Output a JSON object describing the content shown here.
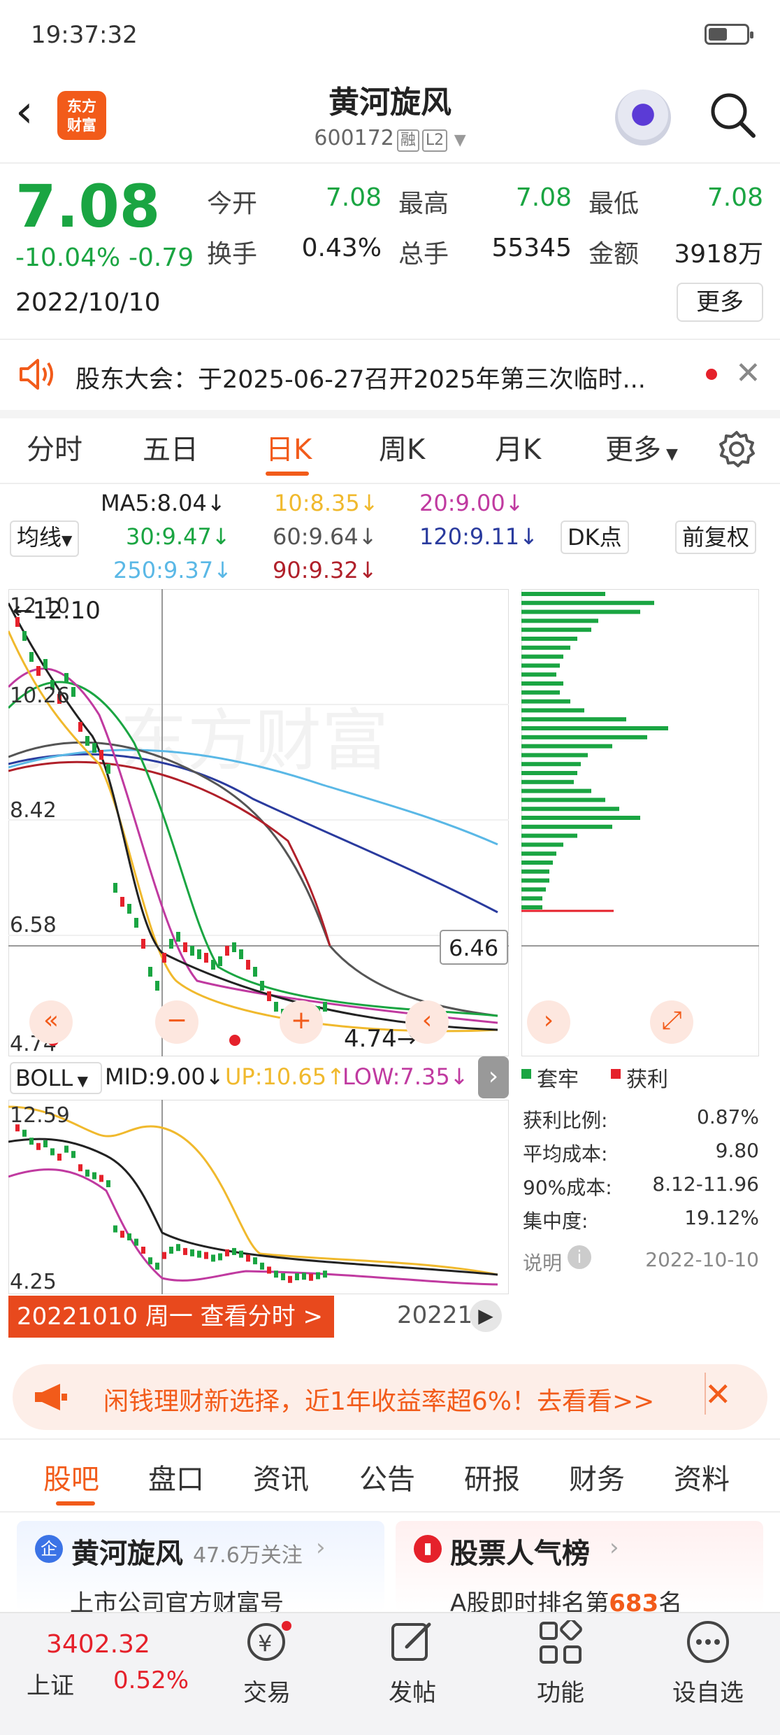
{
  "status_bar": {
    "time": "19:37:32"
  },
  "header": {
    "brand": "东方财富",
    "stock_name": "黄河旋风",
    "stock_code": "600172",
    "tag_margin": "融",
    "tag_level": "L2"
  },
  "quote": {
    "price": "7.08",
    "change_pct": "-10.04%",
    "change": "-0.79",
    "date": "2022/10/10",
    "fields": [
      {
        "label": "今开",
        "value": "7.08",
        "color": "#1aa542"
      },
      {
        "label": "最高",
        "value": "7.08",
        "color": "#1aa542"
      },
      {
        "label": "最低",
        "value": "7.08",
        "color": "#1aa542"
      },
      {
        "label": "换手",
        "value": "0.43%",
        "color": "#222222"
      },
      {
        "label": "总手",
        "value": "55345",
        "color": "#222222"
      },
      {
        "label": "金额",
        "value": "3918万",
        "color": "#222222"
      }
    ],
    "more_label": "更多"
  },
  "notice": {
    "text": "股东大会：于2025-06-27召开2025年第三次临时..."
  },
  "chart_tabs": {
    "items": [
      "分时",
      "五日",
      "日K",
      "周K",
      "月K",
      "更多"
    ],
    "active": "日K"
  },
  "ma": {
    "selector": "均线",
    "ma5": "MA5:8.04↓",
    "ma10": "10:8.35↓",
    "ma20": "20:9.00↓",
    "ma30": "30:9.47↓",
    "ma60": "60:9.64↓",
    "ma120": "120:9.11↓",
    "ma250": "250:9.37↓",
    "ma90": "90:9.32↓",
    "dk_label": "DK点",
    "adjust_label": "前复权",
    "colors": {
      "ma5": "#222222",
      "ma10": "#f0b92d",
      "ma20": "#c03aa0",
      "ma30": "#1aa542",
      "ma60": "#555555",
      "ma120": "#2a3b9e",
      "ma250": "#5ab8e6",
      "ma90": "#b0202a"
    }
  },
  "kline": {
    "axis_labels": [
      "12.10",
      "10.26",
      "8.42",
      "6.58",
      "4.74"
    ],
    "high_marker": "12.10",
    "low_marker": "4.74",
    "crosshair_price": "6.46",
    "watermark": "东方财富"
  },
  "boll": {
    "selector": "BOLL",
    "mid": "MID:9.00↓",
    "up": "UP:10.65↑",
    "low": "LOW:7.35↓",
    "axis_top": "12.59",
    "axis_bottom": "4.25"
  },
  "chip": {
    "legend_trapped": "套牢",
    "legend_profit": "获利",
    "stats": [
      {
        "label": "获利比例:",
        "value": "0.87%"
      },
      {
        "label": "平均成本:",
        "value": "9.80"
      },
      {
        "label": "90%成本:",
        "value": "8.12-11.96"
      },
      {
        "label": "集中度:",
        "value": "19.12%"
      }
    ],
    "note_label": "说明",
    "note_date": "2022-10-10"
  },
  "timeline_link": {
    "text": "20221010 周一 查看分时 >",
    "date_tail": "20221"
  },
  "ad": {
    "text": "闲钱理财新选择，近1年收益率超6%！去看看>>"
  },
  "section_tabs": {
    "items": [
      "股吧",
      "盘口",
      "资讯",
      "公告",
      "研报",
      "财务",
      "资料"
    ],
    "active": "股吧"
  },
  "cards": {
    "left_title": "黄河旋风",
    "left_follow": "47.6万关注",
    "left_sub": "上市公司官方财富号",
    "right_title": "股票人气榜",
    "right_sub_prefix": "A股即时排名第",
    "right_rank": "683",
    "right_sub_suffix": "名"
  },
  "bottom_nav": {
    "index_value": "3402.32",
    "index_name": "上证",
    "index_change": "0.52%",
    "items": [
      "交易",
      "发帖",
      "功能",
      "设自选"
    ]
  }
}
